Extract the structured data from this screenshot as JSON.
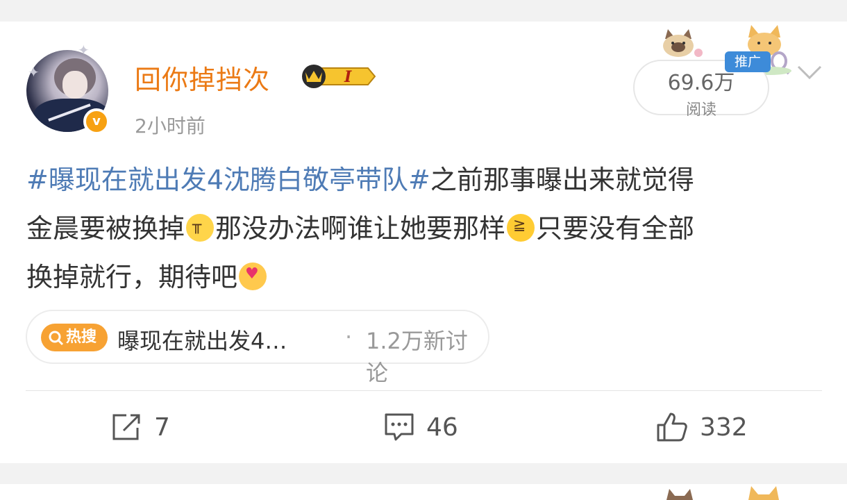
{
  "post": {
    "username": "回你掉挡次",
    "vip_level": "I",
    "verified_mark": "v",
    "timestamp": "2小时前",
    "read_count": "69.6万",
    "read_label": "阅读",
    "promo_badge": "推广",
    "text": {
      "hashtag": "#曝现在就出发4沈腾白敬亭带队#",
      "line1_rest": "之前那事曝出来就觉得",
      "seg2": "金晨要被换掉",
      "seg3": "那没办法啊谁让她要那样",
      "seg4": "只要没有全部",
      "seg5": "换掉就行，期待吧"
    },
    "hot_search": {
      "tag_label": "热搜",
      "title": "曝现在就出发4…",
      "separator": "·",
      "count": "1.2万新讨论"
    },
    "actions": {
      "share_count": "7",
      "comment_count": "46",
      "like_count": "332"
    }
  },
  "colors": {
    "username": "#eb7a15",
    "hashtag": "#4e7bb5",
    "hot_tag": "#f7a233",
    "promo_badge": "#3d8bd9",
    "verified": "#f7a112"
  },
  "icons": [
    "chevron-down-icon",
    "share-icon",
    "comment-icon",
    "like-icon",
    "search-icon",
    "crown-icon"
  ]
}
